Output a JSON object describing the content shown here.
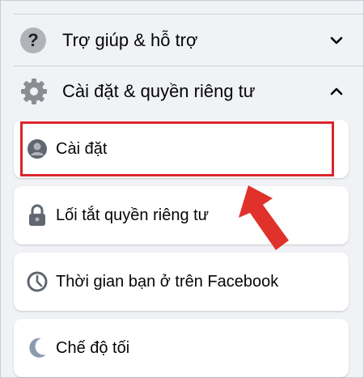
{
  "help_section": {
    "label": "Trợ giúp & hỗ trợ",
    "icon": "question-mark-icon",
    "state": "collapsed"
  },
  "settings_section": {
    "label": "Cài đặt & quyền riêng tư",
    "icon": "gear-icon",
    "state": "expanded"
  },
  "items": [
    {
      "label": "Cài đặt",
      "icon": "user-avatar-icon"
    },
    {
      "label": "Lối tắt quyền riêng tư",
      "icon": "lock-icon"
    },
    {
      "label": "Thời gian bạn ở trên Facebook",
      "icon": "clock-icon"
    },
    {
      "label": "Chế độ tối",
      "icon": "moon-icon"
    }
  ],
  "colors": {
    "background": "#f0f2f5",
    "highlight": "#d9262c",
    "arrow": "#e0322b"
  }
}
